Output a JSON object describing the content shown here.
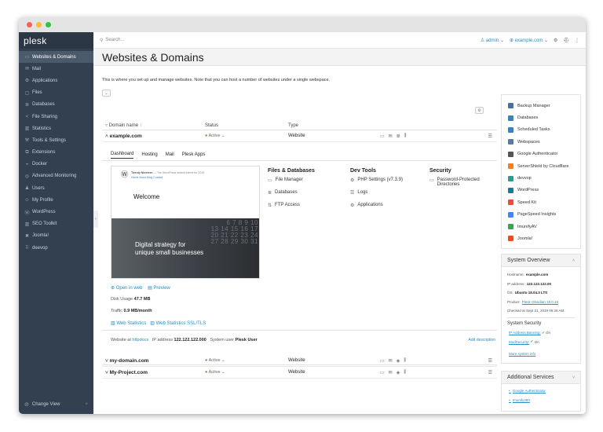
{
  "window": {
    "dots": [
      "#ff5f57",
      "#febc2e",
      "#28c840"
    ]
  },
  "sidebar": {
    "logo": "plesk",
    "items": [
      {
        "label": "Websites & Domains",
        "icon": "monitor-icon",
        "glyph": "▭"
      },
      {
        "label": "Mail",
        "icon": "mail-icon",
        "glyph": "✉"
      },
      {
        "label": "Applications",
        "icon": "applications-icon",
        "glyph": "⚙"
      },
      {
        "label": "Files",
        "icon": "folder-icon",
        "glyph": "▢"
      },
      {
        "label": "Databases",
        "icon": "database-icon",
        "glyph": "≣"
      },
      {
        "label": "File Sharing",
        "icon": "share-icon",
        "glyph": "<"
      },
      {
        "label": "Statistics",
        "icon": "chart-icon",
        "glyph": "▥"
      },
      {
        "label": "Tools & Settings",
        "icon": "tools-icon",
        "glyph": "⚒"
      },
      {
        "label": "Extensions",
        "icon": "extensions-icon",
        "glyph": "⧉"
      },
      {
        "label": "Docker",
        "icon": "docker-icon",
        "glyph": "◒"
      },
      {
        "label": "Advanced Monitoring",
        "icon": "monitoring-icon",
        "glyph": "◎"
      },
      {
        "label": "Users",
        "icon": "users-icon",
        "glyph": "♟"
      },
      {
        "label": "My Profile",
        "icon": "profile-icon",
        "glyph": "☺"
      },
      {
        "label": "WordPress",
        "icon": "wordpress-icon",
        "glyph": "Ⓦ"
      },
      {
        "label": "SEO Toolkit",
        "icon": "seo-icon",
        "glyph": "▥"
      },
      {
        "label": "Joomla!",
        "icon": "joomla-icon",
        "glyph": "✖"
      },
      {
        "label": "deevop",
        "icon": "deevop-icon",
        "glyph": "⠿"
      }
    ],
    "footer_label": "Change View",
    "footer_close": "×"
  },
  "topbar": {
    "search_placeholder": "Search...",
    "user": "admin",
    "domain": "example.com"
  },
  "page": {
    "title": "Websites & Domains",
    "intro": "This is where you set up and manage websites. Note that you can host a number of websites under a single webspace."
  },
  "table": {
    "headers": {
      "domain": "Domain name",
      "sort": "↑",
      "status": "Status",
      "type": "Type"
    },
    "rows": [
      {
        "domain": "example.com",
        "status": "Active",
        "type": "Website"
      },
      {
        "domain": "my-domain.com",
        "status": "Active",
        "type": "Website"
      },
      {
        "domain": "My-Project.com",
        "status": "Active",
        "type": "Website"
      }
    ]
  },
  "detail": {
    "tabs": [
      "Dashboard",
      "Hosting",
      "Mail",
      "Plesk Apps"
    ],
    "preview": {
      "site_name": "Twenty Nineteen",
      "tagline": "— The WordPress default theme for 2019",
      "menu": "Home   About   Blog   Contact",
      "welcome": "Welcome",
      "strategy_line1": "Digital strategy for",
      "strategy_line2": "unique small businesses",
      "calendar": [
        "6 7 8 9 10",
        "13 14 15 16 17",
        "20 21 22 23 24",
        "27 28 29 30 31"
      ]
    },
    "open_in_web": "Open in web",
    "preview_label": "Preview",
    "disk_usage_label": "Disk Usage",
    "disk_usage": "47.7 MB",
    "traffic_label": "Traffic",
    "traffic": "0.9 MB/month",
    "web_stats": "Web Statistics",
    "web_stats_ssl": "Web Statistics SSL/TLS",
    "website_at_label": "Website at",
    "website_at": "httpdocs",
    "ip_label": "IP address",
    "ip": "122.122.122.000",
    "sysuser_label": "System user",
    "sysuser": "Plesk User",
    "add_description": "Add description",
    "files_db": {
      "title": "Files & Databases",
      "items": [
        "File Manager",
        "Databases",
        "FTP Access"
      ]
    },
    "dev_tools": {
      "title": "Dev Tools",
      "items": [
        "PHP Settings (v7.3.9)",
        "Logs",
        "Applications"
      ]
    },
    "security": {
      "title": "Security",
      "items": [
        "Password-Protected Directories"
      ]
    }
  },
  "right_links": [
    {
      "label": "Backup Manager",
      "color": "#4a6fa5",
      "icon": "backup-icon"
    },
    {
      "label": "Databases",
      "color": "#3b7fc4",
      "icon": "database-icon"
    },
    {
      "label": "Scheduled Tasks",
      "color": "#3b7fc4",
      "icon": "calendar-icon"
    },
    {
      "label": "Webspaces",
      "color": "#5a7aa5",
      "icon": "webspaces-icon"
    },
    {
      "label": "Google Authenticator",
      "color": "#555555",
      "icon": "authenticator-icon"
    },
    {
      "label": "ServerShield by Cloudflare",
      "color": "#f38020",
      "icon": "cloudflare-icon"
    },
    {
      "label": "devvop",
      "color": "#2a9d8f",
      "icon": "devvop-icon"
    },
    {
      "label": "WordPress",
      "color": "#21759b",
      "icon": "wordpress-icon"
    },
    {
      "label": "Speed Kit",
      "color": "#e74c3c",
      "icon": "speedkit-icon"
    },
    {
      "label": "PageSpeed Insights",
      "color": "#4285f4",
      "icon": "pagespeed-icon"
    },
    {
      "label": "ImunifyAV",
      "color": "#3aa655",
      "icon": "imunify-icon"
    },
    {
      "label": "Joomla!",
      "color": "#e44d26",
      "icon": "joomla-icon"
    }
  ],
  "overview": {
    "title": "System Overview",
    "hostname_label": "Hostname:",
    "hostname": "example.com",
    "ip_label": "IP address:",
    "ip": "122.122.122.00",
    "os_label": "OS:",
    "os": "Ubuntu 18.04.3 LTS",
    "product_label": "Product:",
    "product": "Plesk Obsidian 18.0.19",
    "checked": "Checked at Sept 21, 2019 06:25 AM.",
    "security_title": "System Security",
    "ip_banning": "IP Address Banning:",
    "ip_banning_state": "On",
    "modsecurity": "ModSecurity:",
    "modsecurity_state": "On",
    "more_info": "More system info"
  },
  "services": {
    "title": "Additional Services",
    "items": [
      "Google Authenticator",
      "Imunify360"
    ]
  }
}
